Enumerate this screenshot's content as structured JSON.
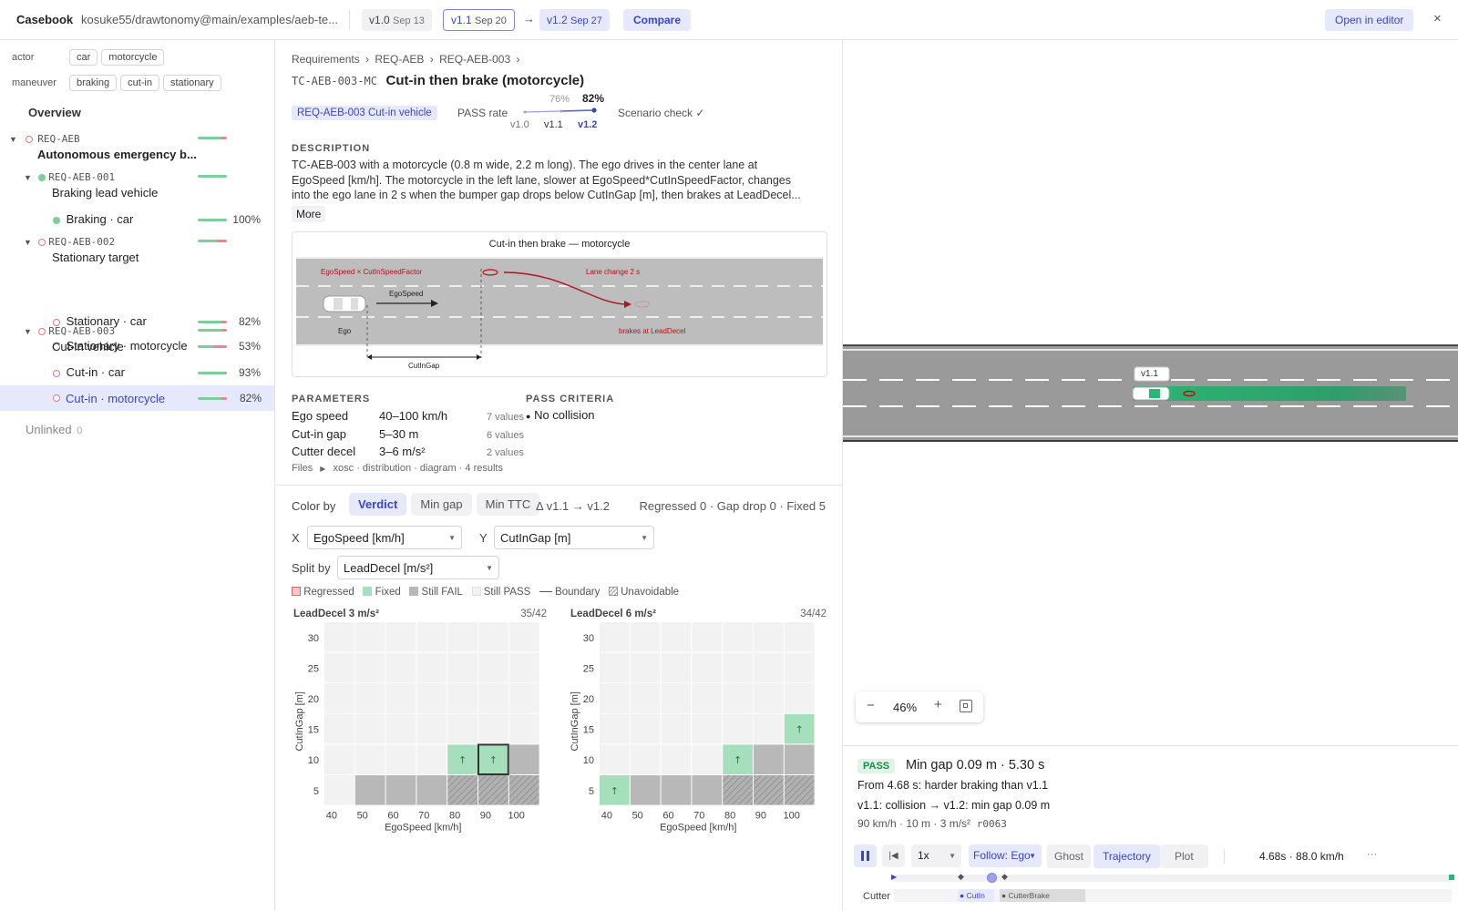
{
  "app": {
    "title": "Casebook",
    "repo": "kosuke55/drawtonomy@main/examples/aeb-te..."
  },
  "versions": [
    {
      "name": "v1.0",
      "date": "Sep 13"
    },
    {
      "name": "v1.1",
      "date": "Sep 20"
    },
    {
      "name": "v1.2",
      "date": "Sep 27"
    }
  ],
  "header": {
    "arrow": "→",
    "compare": "Compare",
    "open_editor": "Open in editor",
    "close": "×"
  },
  "filters": {
    "actor_label": "actor",
    "actor_chips": [
      "car",
      "motorcycle"
    ],
    "maneuver_label": "maneuver",
    "maneuver_chips": [
      "braking",
      "cut-in",
      "stationary"
    ]
  },
  "tree": {
    "overview": "Overview",
    "root": {
      "id": "REQ-AEB",
      "name": "Autonomous emergency b..."
    },
    "req1": {
      "id": "REQ-AEB-001",
      "name": "Braking lead vehicle",
      "items": [
        {
          "label": "Braking · car",
          "pct": "100%"
        }
      ]
    },
    "req2": {
      "id": "REQ-AEB-002",
      "name": "Stationary target",
      "items": [
        {
          "label": "Stationary · car",
          "pct": "82%"
        },
        {
          "label": "Stationary · motorcycle",
          "pct": "53%"
        }
      ]
    },
    "req3": {
      "id": "REQ-AEB-003",
      "name": "Cut-in vehicle",
      "items": [
        {
          "label": "Cut-in · car",
          "pct": "93%"
        },
        {
          "label": "Cut-in · motorcycle",
          "pct": "82%"
        }
      ]
    },
    "unlinked": "Unlinked",
    "unlinked_count": "0"
  },
  "detail": {
    "breadcrumb": [
      "Requirements",
      "REQ-AEB",
      "REQ-AEB-003"
    ],
    "sep": "›",
    "case_id": "TC-AEB-003-MC",
    "title": "Cut-in then brake (motorcycle)",
    "req_tag": "REQ-AEB-003 Cut-in vehicle",
    "pass_rate_label": "PASS rate",
    "pass_prev": "76%",
    "pass_now": "82%",
    "spark_versions": [
      "v1.0",
      "v1.1",
      "v1.2"
    ],
    "scenario_check": "Scenario check ✓",
    "desc_header": "DESCRIPTION",
    "desc_lines": [
      "TC-AEB-003 with a motorcycle (0.8 m wide, 2.2 m long). The ego drives in the center lane at",
      "EgoSpeed [km/h]. The motorcycle in the left lane, slower at EgoSpeed*CutInSpeedFactor, changes",
      "into the ego lane in 2 s when the bumper gap drops below CutInGap [m], then brakes at LeadDecel..."
    ],
    "more": "More",
    "diagram": {
      "title": "Cut-in then brake — motorcycle",
      "lbl_speed_factor": "EgoSpeed × CutInSpeedFactor",
      "lbl_lane_change": "Lane change 2 s",
      "lbl_egospeed": "EgoSpeed",
      "lbl_ego": "Ego",
      "lbl_brakes": "brakes at LeadDecel",
      "lbl_gap": "CutInGap"
    },
    "params_header": "PARAMETERS",
    "params": [
      {
        "name": "Ego speed",
        "range": "40–100 km/h",
        "count": "7 values"
      },
      {
        "name": "Cut-in gap",
        "range": "5–30 m",
        "count": "6 values"
      },
      {
        "name": "Cutter decel",
        "range": "3–6 m/s²",
        "count": "2 values"
      }
    ],
    "criteria_header": "PASS CRITERIA",
    "criteria": [
      "No collision"
    ],
    "files_label": "Files",
    "files_value": "xosc · distribution · diagram · 4 results"
  },
  "analysis": {
    "color_by": "Color by",
    "modes": [
      "Verdict",
      "Min gap",
      "Min TTC"
    ],
    "delta": "Δ v1.1 → v1.2",
    "summary": "Regressed 0 · Gap drop 0 · Fixed 5",
    "x_label": "X",
    "x_value": "EgoSpeed [km/h]",
    "y_label": "Y",
    "y_value": "CutInGap [m]",
    "split_label": "Split by",
    "split_value": "LeadDecel [m/s²]",
    "legend": [
      "Regressed",
      "Fixed",
      "Still FAIL",
      "Still PASS",
      "Boundary",
      "Unavoidable"
    ]
  },
  "chart_data": [
    {
      "type": "heatmap",
      "title": "LeadDecel 3 m/s²",
      "count": "35/42",
      "xlabel": "EgoSpeed [km/h]",
      "ylabel": "CutInGap [m]",
      "x": [
        40,
        50,
        60,
        70,
        80,
        90,
        100
      ],
      "y": [
        5,
        10,
        15,
        20,
        25,
        30
      ],
      "cells": [
        [
          "pass",
          "fail",
          "fail",
          "fail",
          "fail-u",
          "fail-u",
          "fail-u"
        ],
        [
          "pass",
          "pass",
          "pass",
          "pass",
          "fixed",
          "fixed-sel",
          "fail"
        ],
        [
          "pass",
          "pass",
          "pass",
          "pass",
          "pass",
          "pass",
          "pass"
        ],
        [
          "pass",
          "pass",
          "pass",
          "pass",
          "pass",
          "pass",
          "pass"
        ],
        [
          "pass",
          "pass",
          "pass",
          "pass",
          "pass",
          "pass",
          "pass"
        ],
        [
          "pass",
          "pass",
          "pass",
          "pass",
          "pass",
          "pass",
          "pass"
        ]
      ]
    },
    {
      "type": "heatmap",
      "title": "LeadDecel 6 m/s²",
      "count": "34/42",
      "xlabel": "EgoSpeed [km/h]",
      "ylabel": "CutInGap [m]",
      "x": [
        40,
        50,
        60,
        70,
        80,
        90,
        100
      ],
      "y": [
        5,
        10,
        15,
        20,
        25,
        30
      ],
      "cells": [
        [
          "fixed",
          "fail",
          "fail",
          "fail",
          "fail-u",
          "fail-u",
          "fail-u"
        ],
        [
          "pass",
          "pass",
          "pass",
          "pass",
          "fixed",
          "fail",
          "fail"
        ],
        [
          "pass",
          "pass",
          "pass",
          "pass",
          "pass",
          "pass",
          "fixed"
        ],
        [
          "pass",
          "pass",
          "pass",
          "pass",
          "pass",
          "pass",
          "pass"
        ],
        [
          "pass",
          "pass",
          "pass",
          "pass",
          "pass",
          "pass",
          "pass"
        ],
        [
          "pass",
          "pass",
          "pass",
          "pass",
          "pass",
          "pass",
          "pass"
        ]
      ]
    }
  ],
  "viewer": {
    "ghost_label": "v1.1",
    "zoom": "46%",
    "zoom_minus": "−",
    "zoom_plus": "+",
    "verdict": "PASS",
    "result_title": "Min gap 0.09 m · 5.30 s",
    "result_line1": "From 4.68 s: harder braking than v1.1",
    "result_line2": "v1.1: collision → v1.2: min gap 0.09 m",
    "result_params": "90 km/h · 10 m · 3 m/s²",
    "result_run": "r0063",
    "speed": "1x",
    "follow": "Follow: Ego",
    "ghost": "Ghost",
    "trajectory": "Trajectory",
    "plot": "Plot",
    "time_readout": "4.68s · 88.0 km/h",
    "more": "···",
    "playhead_fraction": 0.175,
    "track_label": "Cutter",
    "events": [
      "CutIn",
      "CutterBrake"
    ]
  },
  "colors": {
    "accent": "#3b45c4",
    "pass_green": "#2bb673",
    "fixed_green": "#a6dfbb",
    "fail_gray": "#b8b8b8",
    "regress_red": "#e06666",
    "red_line": "#b5121b"
  }
}
